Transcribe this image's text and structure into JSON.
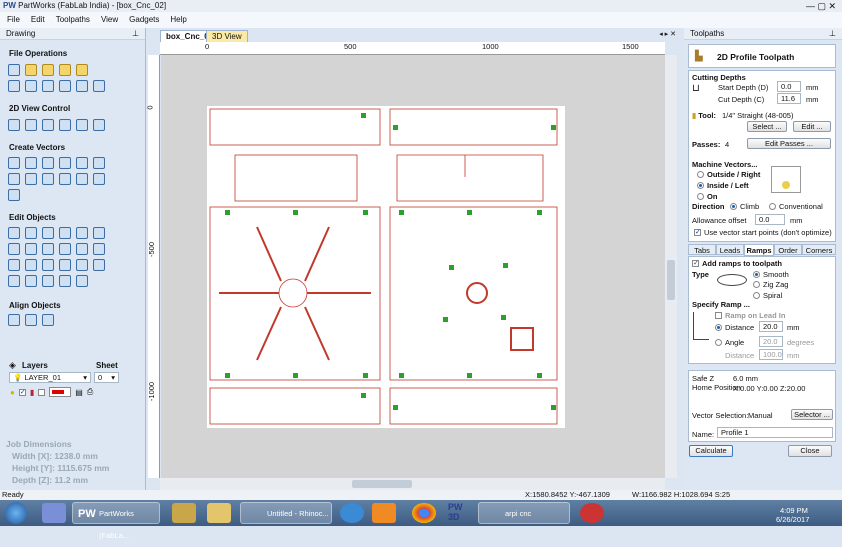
{
  "window": {
    "title": "PartWorks (FabLab India) - [box_Cnc_02]",
    "logo": "PW"
  },
  "menu": [
    "File",
    "Edit",
    "Toolpaths",
    "View",
    "Gadgets",
    "Help"
  ],
  "left_panel": {
    "title": "Drawing",
    "sections": [
      "File Operations",
      "2D View Control",
      "Create Vectors",
      "Edit Objects",
      "Align Objects"
    ],
    "layers_label": "Layers",
    "sheet_label": "Sheet",
    "layer_value": "LAYER_01",
    "sheet_value": "0",
    "job_dimensions": {
      "title": "Job Dimensions",
      "width": "Width  [X]: 1238.0 mm",
      "height": "Height [Y]: 1115.675 mm",
      "depth": "Depth  [Z]: 11.2 mm"
    }
  },
  "doc_tabs": [
    {
      "label": "box_Cnc_02",
      "active": true
    },
    {
      "label": "3D View",
      "active": false
    }
  ],
  "ruler": {
    "top": [
      "0",
      "500",
      "1000",
      "1500"
    ],
    "left": [
      "0",
      "-500",
      "-1000"
    ]
  },
  "right_panel": {
    "title": "Toolpaths",
    "header": "2D Profile Toolpath",
    "cutting_depths": "Cutting Depths",
    "start_depth_label": "Start Depth (D)",
    "start_depth": "0.0",
    "cut_depth_label": "Cut Depth (C)",
    "cut_depth": "11.6",
    "unit": "mm",
    "tool_label": "Tool:",
    "tool_value": "1/4\" Straight  (48-005)",
    "select_btn": "Select ...",
    "edit_btn": "Edit ...",
    "passes_label": "Passes:",
    "passes_value": "4",
    "edit_passes_btn": "Edit Passes ...",
    "machine_vectors": "Machine Vectors...",
    "outside": "Outside / Right",
    "inside": "Inside / Left",
    "on": "On",
    "direction": "Direction",
    "climb": "Climb",
    "conventional": "Conventional",
    "allowance_label": "Allowance offset",
    "allowance": "0.0",
    "use_start_points": "Use vector start points (don't optimize)",
    "tabs": [
      "Tabs",
      "Leads",
      "Ramps",
      "Order",
      "Corners"
    ],
    "active_tab": "Ramps",
    "add_ramps": "Add ramps to toolpath",
    "type_label": "Type",
    "smooth": "Smooth",
    "zigzag": "Zig Zag",
    "spiral": "Spiral",
    "specify_ramp": "Specify Ramp ...",
    "ramp_lead_in": "Ramp on Lead In",
    "distance_label": "Distance",
    "distance": "20.0",
    "angle_label": "Angle",
    "angle": "20.0",
    "degrees": "degrees",
    "distance2_label": "Distance",
    "distance2": "100.0",
    "safe_z_label": "Safe Z",
    "safe_z": "6.0 mm",
    "home_label": "Home Position",
    "home": "X:0.00 Y:0.00 Z:20.00",
    "vector_selection_label": "Vector Selection:",
    "vector_selection": "Manual",
    "selector_btn": "Selector ...",
    "name_label": "Name:",
    "name_value": "Profile 1",
    "calculate_btn": "Calculate",
    "close_btn": "Close"
  },
  "status": {
    "left": "Ready",
    "coords": "X:1580.8452 Y:-467.1309",
    "size": "W:1166.982  H:1028.694  S:25"
  },
  "taskbar": {
    "items": [
      "PartWorks (FabLa...",
      "Untitled - Rhinoc...",
      "arpi cnc"
    ],
    "time": "4:09 PM",
    "date": "6/26/2017",
    "pw3d": "PW 3D"
  },
  "colors": {
    "vector": "#c0392b",
    "panel": "#dce7f3"
  }
}
